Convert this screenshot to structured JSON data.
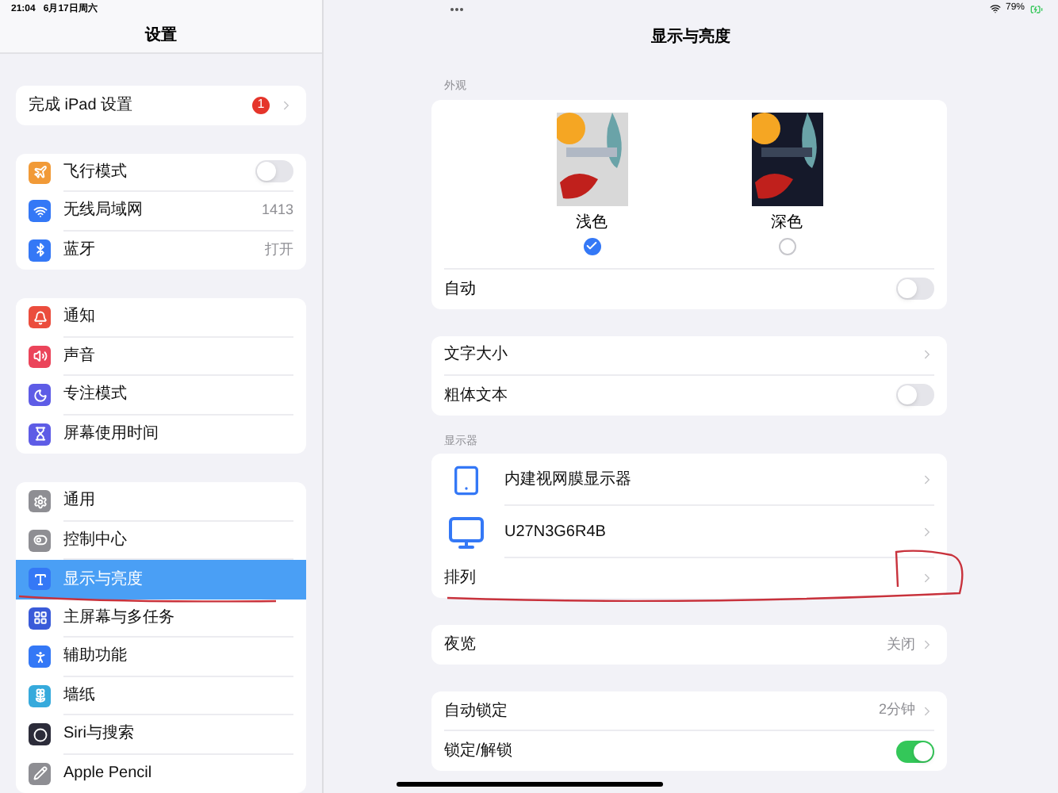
{
  "status_bar": {
    "time": "21:04",
    "date": "6月17日周六",
    "battery": "79%"
  },
  "sidebar": {
    "title": "设置",
    "groups": [
      [
        {
          "label": "完成 iPad 设置",
          "kind": "badge",
          "badge": "1",
          "selected": false
        }
      ],
      [
        {
          "label": "飞行模式",
          "kind": "toggle",
          "on": false,
          "color": "#f19a37",
          "selected": false
        },
        {
          "label": "无线局域网",
          "kind": "value",
          "value": "1413",
          "color": "#3478f6",
          "selected": false
        },
        {
          "label": "蓝牙",
          "kind": "value",
          "value": "打开",
          "color": "#3478f6",
          "selected": false
        }
      ],
      [
        {
          "label": "通知",
          "kind": "plain",
          "color": "#eb4d3d",
          "selected": false
        },
        {
          "label": "声音",
          "kind": "plain",
          "color": "#eb445a",
          "selected": false
        },
        {
          "label": "专注模式",
          "kind": "plain",
          "color": "#5e5ce6",
          "selected": false
        },
        {
          "label": "屏幕使用时间",
          "kind": "plain",
          "color": "#5e5ce6",
          "selected": false
        }
      ],
      [
        {
          "label": "通用",
          "kind": "plain",
          "color": "#8e8e93",
          "selected": false
        },
        {
          "label": "控制中心",
          "kind": "plain",
          "color": "#8e8e93",
          "selected": false
        },
        {
          "label": "显示与亮度",
          "kind": "plain",
          "color": "#3478f6",
          "selected": true
        },
        {
          "label": "主屏幕与多任务",
          "kind": "plain",
          "color": "#3a5bd9",
          "selected": false
        },
        {
          "label": "辅助功能",
          "kind": "plain",
          "color": "#3478f6",
          "selected": false
        },
        {
          "label": "墙纸",
          "kind": "plain",
          "color": "#36aadc",
          "selected": false
        },
        {
          "label": "Siri与搜索",
          "kind": "plain",
          "color": "#2c2c3a",
          "selected": false
        },
        {
          "label": "Apple Pencil",
          "kind": "plain",
          "color": "#8e8e93",
          "selected": false
        }
      ]
    ]
  },
  "detail": {
    "title": "显示与亮度",
    "appearance": {
      "header": "外观",
      "options": [
        {
          "label": "浅色",
          "kind": "light",
          "selected": true
        },
        {
          "label": "深色",
          "kind": "dark",
          "selected": false
        }
      ],
      "auto": {
        "label": "自动",
        "on": false
      }
    },
    "sections": [
      {
        "rows": [
          {
            "label": "文字大小",
            "kind": "chevron"
          },
          {
            "label": "粗体文本",
            "kind": "toggle",
            "on": false
          }
        ]
      },
      {
        "header": "显示器",
        "rows": [
          {
            "label": "内建视网膜显示器",
            "kind": "tablet"
          },
          {
            "label": "U27N3G6R4B",
            "kind": "monitor"
          },
          {
            "label": "排列",
            "kind": "chevron"
          }
        ]
      },
      {
        "rows": [
          {
            "label": "夜览",
            "kind": "value",
            "value": "关闭"
          }
        ]
      },
      {
        "rows": [
          {
            "label": "自动锁定",
            "kind": "value",
            "value": "2分钟"
          },
          {
            "label": "锁定/解锁",
            "kind": "toggle",
            "on": true
          }
        ]
      }
    ]
  }
}
